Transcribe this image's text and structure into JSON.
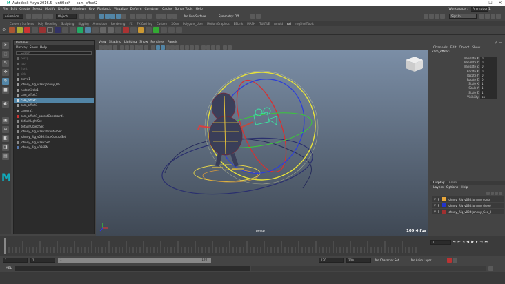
{
  "window": {
    "title": "Autodesk Maya 2016.5 - untitled* --- cam_offset2",
    "controls": [
      "—",
      "☐",
      "✕"
    ]
  },
  "menubar": [
    "File",
    "Edit",
    "Create",
    "Select",
    "Modify",
    "Display",
    "Windows",
    "Key",
    "Playback",
    "Visualize",
    "Deform",
    "Constrain",
    "Cache",
    "Bonus Tools",
    "Help"
  ],
  "status": {
    "menuset": "Animation",
    "selmode": "Objects",
    "live_surface": "No Live Surface",
    "symmetry": "Symmetry: Off",
    "workspace_label": "Workspace :",
    "workspace": "Animation1",
    "sign_in": "Sign In"
  },
  "shelf": {
    "tabs": [
      "Curves / Surfaces",
      "Poly Modeling",
      "Sculpting",
      "Rigging",
      "Animation",
      "Rendering",
      "FX",
      "FX Caching",
      "Custom",
      "XGen",
      "Polygons_User",
      "Motion Graphics",
      "BBLink",
      "MASH",
      "TURTLE",
      "Arnold",
      "Anl",
      "mgShelfTools"
    ],
    "active_tab": "Anl",
    "buttons": [
      "SPK",
      "Retrl",
      "Hlvl",
      "IT",
      "CP",
      "Anima",
      "OAB",
      "1Tl",
      "Reus",
      "HKill",
      "TAS",
      "EF",
      "cam",
      "",
      "",
      "",
      "",
      "",
      "",
      "",
      "PBrep",
      "HKloop",
      "Brep"
    ]
  },
  "outliner": {
    "title": "Outliner",
    "menu": [
      "Display",
      "Show",
      "Help"
    ],
    "search_placeholder": "Search...",
    "items": [
      {
        "label": "persp",
        "dim": true,
        "sel": false,
        "color": "#666"
      },
      {
        "label": "top",
        "dim": true,
        "sel": false,
        "color": "#666"
      },
      {
        "label": "front",
        "dim": true,
        "sel": false,
        "color": "#666"
      },
      {
        "label": "side",
        "dim": true,
        "sel": false,
        "color": "#666"
      },
      {
        "label": "curve1",
        "dim": false,
        "sel": false,
        "color": "#999"
      },
      {
        "label": "Johnny_Rig_v036:Johnny_BG",
        "dim": false,
        "sel": false,
        "color": "#999"
      },
      {
        "label": "nodesCircle1",
        "dim": false,
        "sel": false,
        "color": "#999"
      },
      {
        "label": "cam_offset1",
        "dim": false,
        "sel": false,
        "color": "#999"
      },
      {
        "label": "cam_offset2",
        "dim": false,
        "sel": true,
        "color": "#ddd"
      },
      {
        "label": "cam_offset3",
        "dim": false,
        "sel": false,
        "color": "#999"
      },
      {
        "label": "camera1",
        "dim": false,
        "sel": false,
        "color": "#999"
      },
      {
        "label": "cam_offset1_parentConstraint1",
        "dim": false,
        "sel": false,
        "color": "#c33"
      },
      {
        "label": "defaultLightSet",
        "dim": false,
        "sel": false,
        "color": "#888"
      },
      {
        "label": "defaultObjectSet",
        "dim": false,
        "sel": false,
        "color": "#888"
      },
      {
        "label": "Johnny_Rig_v036:ParentAllSet",
        "dim": false,
        "sel": false,
        "color": "#888"
      },
      {
        "label": "Johnny_Rig_v036:FaceControlSet",
        "dim": false,
        "sel": false,
        "color": "#888"
      },
      {
        "label": "Johnny_Rig_v036:Set",
        "dim": false,
        "sel": false,
        "color": "#888"
      },
      {
        "label": "Johnny_Rig_v036RN",
        "dim": false,
        "sel": false,
        "color": "#57a"
      }
    ]
  },
  "viewport": {
    "menu": [
      "View",
      "Shading",
      "Lighting",
      "Show",
      "Renderer",
      "Panels"
    ],
    "camera": "persp",
    "fps": "109.4 fps"
  },
  "channelbox": {
    "menu": [
      "Channels",
      "Edit",
      "Object",
      "Show"
    ],
    "object": "cam_offset2",
    "attrs": [
      {
        "name": "Translate X",
        "value": "0"
      },
      {
        "name": "Translate Y",
        "value": "0"
      },
      {
        "name": "Translate Z",
        "value": "0"
      },
      {
        "name": "Rotate X",
        "value": "0"
      },
      {
        "name": "Rotate Y",
        "value": "0"
      },
      {
        "name": "Rotate Z",
        "value": "0"
      },
      {
        "name": "Scale X",
        "value": "1"
      },
      {
        "name": "Scale Y",
        "value": "1"
      },
      {
        "name": "Scale Z",
        "value": "1"
      },
      {
        "name": "Visibility",
        "value": "on"
      }
    ]
  },
  "layers": {
    "tabs": [
      "Display",
      "Anim"
    ],
    "menu": [
      "Layers",
      "Options",
      "Help"
    ],
    "rows": [
      {
        "v": "V",
        "p": "P",
        "color": "#e8a63a",
        "name": "Johnny_Rig_v036:Johnny_contr"
      },
      {
        "v": "V",
        "p": "P",
        "color": "#2233cc",
        "name": "Johnny_Rig_v036:Johnny_skelet"
      },
      {
        "v": "V",
        "p": "P",
        "color": "#a03030",
        "name": "Johnny_Rig_v036:Johnny_Geo_L"
      }
    ]
  },
  "timeline": {
    "start": "1",
    "start2": "1",
    "range_start": "1",
    "range_end": "120",
    "end": "120",
    "end2": "200",
    "current_frame": "1",
    "character_set": "No Character Set",
    "anim_layer": "No Anim Layer"
  },
  "cmdline": {
    "label": "MEL"
  },
  "colors": {
    "accent": "#5285a6",
    "viewport_top": "#7b8ea6",
    "viewport_bottom": "#3f4854"
  }
}
